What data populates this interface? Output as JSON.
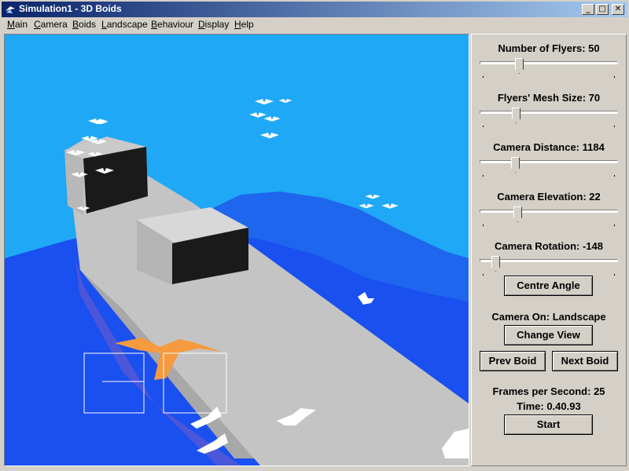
{
  "window": {
    "title": "Simulation1 - 3D Boids",
    "minimize_label": "_",
    "maximize_label": "□",
    "close_label": "✕"
  },
  "menu": {
    "items": [
      {
        "accel": "M",
        "rest": "ain"
      },
      {
        "accel": "C",
        "rest": "amera"
      },
      {
        "accel": "B",
        "rest": "oids"
      },
      {
        "accel": "L",
        "rest": "andscape"
      },
      {
        "accel": "B",
        "rest": "ehaviour"
      },
      {
        "accel": "D",
        "rest": "isplay"
      },
      {
        "accel": "H",
        "rest": "elp"
      }
    ]
  },
  "panel": {
    "flyers_label": "Number of Flyers: 50",
    "mesh_label": "Flyers' Mesh Size: 70",
    "distance_label": "Camera Distance: 1184",
    "elevation_label": "Camera Elevation: 22",
    "rotation_label": "Camera Rotation: -148",
    "centre_button": "Centre Angle",
    "camera_on_label": "Camera On: Landscape",
    "change_view_button": "Change View",
    "prev_boid_button": "Prev Boid",
    "next_boid_button": "Next Boid",
    "fps_label": "Frames per Second: 25",
    "time_label": "Time: 0.40.93",
    "start_button": "Start"
  },
  "sliders": {
    "flyers": 0.27,
    "mesh": 0.25,
    "distance": 0.24,
    "elevation": 0.26,
    "rotation": 0.09
  },
  "colors": {
    "sky": "#1ea8f5",
    "sea": "#1a4ff0",
    "hill": "#1e66ee",
    "concrete": "#c4c4c4",
    "window_dark": "#1a1a1a",
    "lead_boid": "#f59a3e",
    "boid": "#ffffff",
    "titlebar": "#0a246a"
  }
}
